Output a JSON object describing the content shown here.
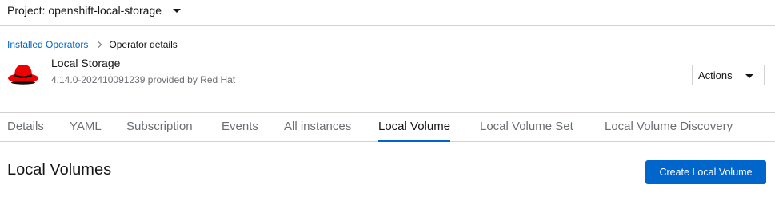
{
  "project": {
    "label": "Project: openshift-local-storage"
  },
  "breadcrumb": {
    "parent": "Installed Operators",
    "current": "Operator details"
  },
  "operator": {
    "name": "Local Storage",
    "subtitle": "4.14.0-202410091239 provided by Red Hat",
    "logo_icon": "redhat-fedora-logo",
    "logo_color": "#ee0000"
  },
  "actions": {
    "label": "Actions"
  },
  "tabs": [
    {
      "label": "Details"
    },
    {
      "label": "YAML"
    },
    {
      "label": "Subscription"
    },
    {
      "label": "Events"
    },
    {
      "label": "All instances"
    },
    {
      "label": "Local Volume",
      "active": true
    },
    {
      "label": "Local Volume Set"
    },
    {
      "label": "Local Volume Discovery"
    }
  ],
  "main": {
    "title": "Local Volumes",
    "create_button": "Create Local Volume"
  },
  "colors": {
    "accent": "#0066cc",
    "text": "#151515",
    "muted": "#6a6e73",
    "border": "#d2d2d2"
  }
}
